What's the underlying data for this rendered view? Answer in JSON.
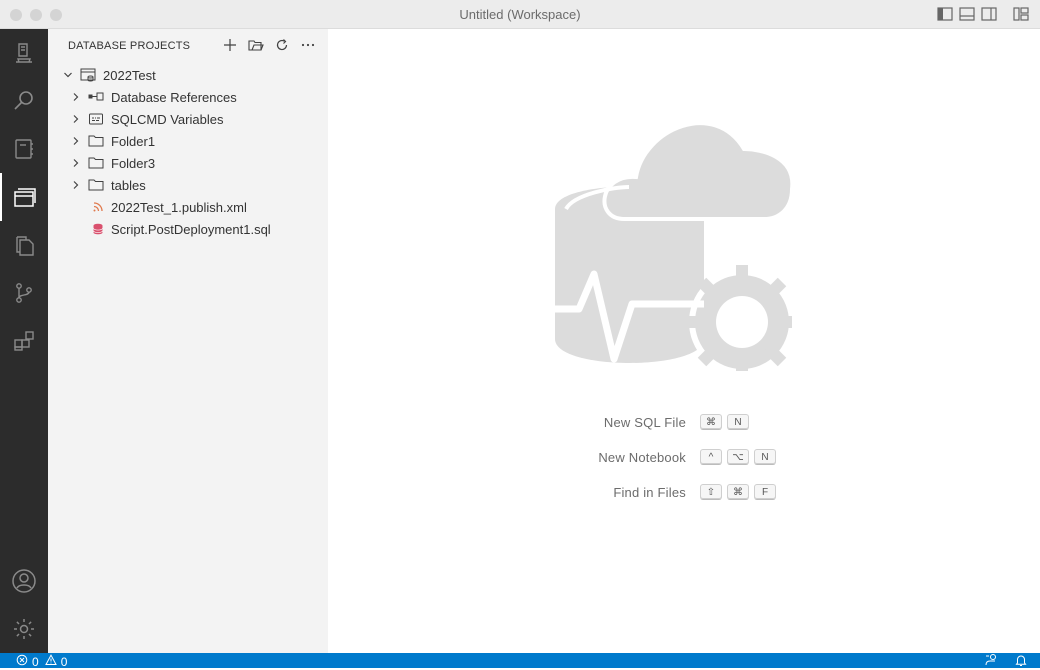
{
  "window": {
    "title": "Untitled (Workspace)"
  },
  "activity_bar": {
    "items": [
      {
        "name": "connections-icon"
      },
      {
        "name": "search-icon"
      },
      {
        "name": "notebooks-icon"
      },
      {
        "name": "database-projects-icon"
      },
      {
        "name": "explorer-icon"
      },
      {
        "name": "source-control-icon"
      },
      {
        "name": "extensions-icon"
      }
    ],
    "bottom": [
      {
        "name": "account-icon"
      },
      {
        "name": "manage-gear-icon"
      }
    ]
  },
  "sidebar": {
    "title": "DATABASE PROJECTS",
    "actions": [
      "new-project-icon",
      "open-project-icon",
      "refresh-icon",
      "more-actions-icon"
    ],
    "tree": {
      "root": {
        "label": "2022Test",
        "expanded": true
      },
      "children": [
        {
          "label": "Database References",
          "icon": "references-icon",
          "collapsible": true
        },
        {
          "label": "SQLCMD Variables",
          "icon": "sqlcmd-variables-icon",
          "collapsible": true
        },
        {
          "label": "Folder1",
          "icon": "folder-icon",
          "collapsible": true
        },
        {
          "label": "Folder3",
          "icon": "folder-icon",
          "collapsible": true
        },
        {
          "label": "tables",
          "icon": "folder-icon",
          "collapsible": true
        },
        {
          "label": "2022Test_1.publish.xml",
          "icon": "rss-publish-icon",
          "collapsible": false
        },
        {
          "label": "Script.PostDeployment1.sql",
          "icon": "sql-database-icon",
          "collapsible": false
        }
      ]
    }
  },
  "editor": {
    "watermark_icon": "azure-data-studio-logo",
    "shortcuts": [
      {
        "label": "New SQL File",
        "keys": [
          "⌘",
          "N"
        ]
      },
      {
        "label": "New Notebook",
        "keys": [
          "^",
          "⌥",
          "N"
        ]
      },
      {
        "label": "Find in Files",
        "keys": [
          "⇧",
          "⌘",
          "F"
        ]
      }
    ]
  },
  "status_bar": {
    "errors": "0",
    "warnings": "0",
    "color": "#007acc"
  }
}
